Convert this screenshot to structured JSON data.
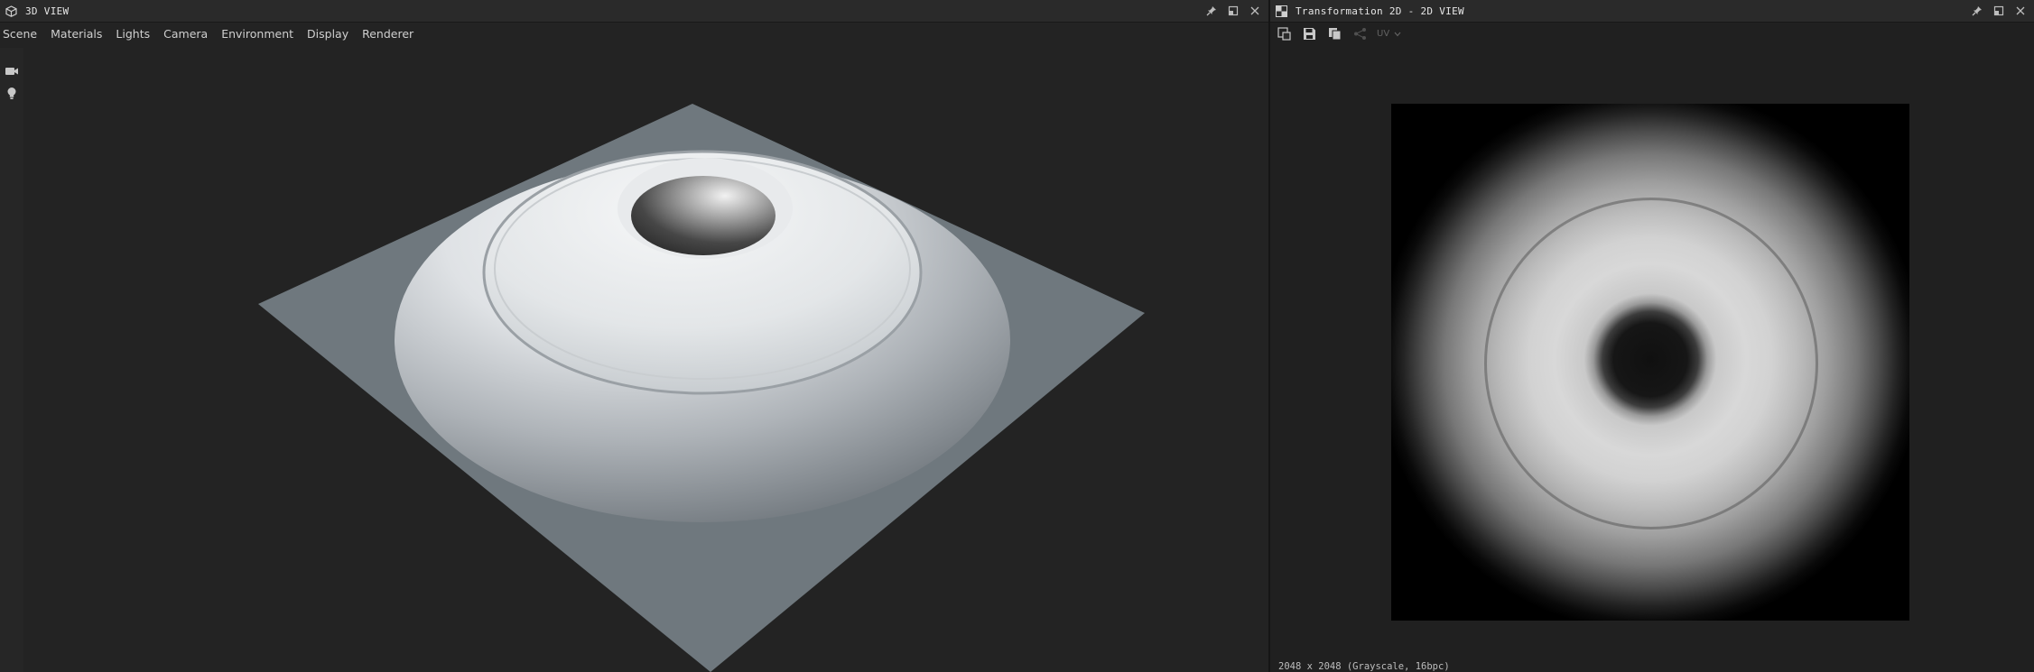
{
  "left_panel": {
    "title": "3D VIEW",
    "menu": [
      "Scene",
      "Materials",
      "Lights",
      "Camera",
      "Environment",
      "Display",
      "Renderer"
    ],
    "icons": {
      "title": "cube-icon",
      "pin": "pin-icon",
      "maximize": "maximize-icon",
      "close": "close-icon",
      "camera": "camera-icon",
      "light": "lightbulb-icon"
    }
  },
  "right_panel": {
    "title": "Transformation 2D - 2D VIEW",
    "toolbar": {
      "uv_label": "UV",
      "icons": [
        "view-mode-icon",
        "save-icon",
        "copy-icon",
        "share-icon"
      ]
    },
    "status": "2048 x 2048 (Grayscale, 16bpc)",
    "icons": {
      "title": "checker-icon",
      "pin": "pin-icon",
      "maximize": "maximize-icon",
      "close": "close-icon"
    }
  },
  "colors": {
    "panel_bg": "#232323",
    "titlebar_bg": "#2a2a2a",
    "plane": "#6f787e",
    "text": "#cfcfcf"
  }
}
